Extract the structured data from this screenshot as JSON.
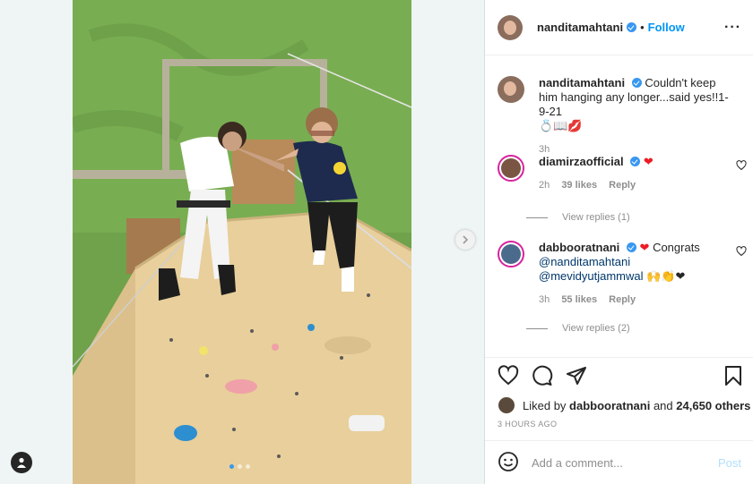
{
  "post": {
    "username": "nanditamahtani",
    "follow_label": "Follow",
    "caption": "Couldn't keep him hanging any longer...said yes!!1-9-21",
    "caption_emoji": "💍📖💋",
    "caption_time": "3h",
    "likes_user": "dabbooratnani",
    "likes_and": "and",
    "likes_others": "24,650 others",
    "liked_by_label": "Liked by",
    "timestamp": "3 HOURS AGO",
    "add_comment_placeholder": "Add a comment...",
    "post_label": "Post"
  },
  "comments": [
    {
      "username": "diamirzaofficial",
      "text": "❤",
      "time": "2h",
      "likes": "39 likes",
      "reply": "Reply",
      "view_replies": "View replies (1)"
    },
    {
      "username": "dabbooratnani",
      "text": "Congrats",
      "mention1": "@nanditamahtani",
      "mention2": "@mevidyutjammwal",
      "emoji": "🙌👏❤",
      "time": "3h",
      "likes": "55 likes",
      "reply": "Reply",
      "view_replies": "View replies (2)"
    }
  ],
  "colors": {
    "accent": "#0095f6",
    "heart": "#ed1c24",
    "verified": "#3897f0",
    "story_ring": "#d6249f"
  },
  "icons": [
    "verified-icon",
    "more-icon",
    "heart-icon",
    "comment-icon",
    "share-icon",
    "bookmark-icon",
    "emoji-icon",
    "chevron-right-icon",
    "user-icon"
  ]
}
